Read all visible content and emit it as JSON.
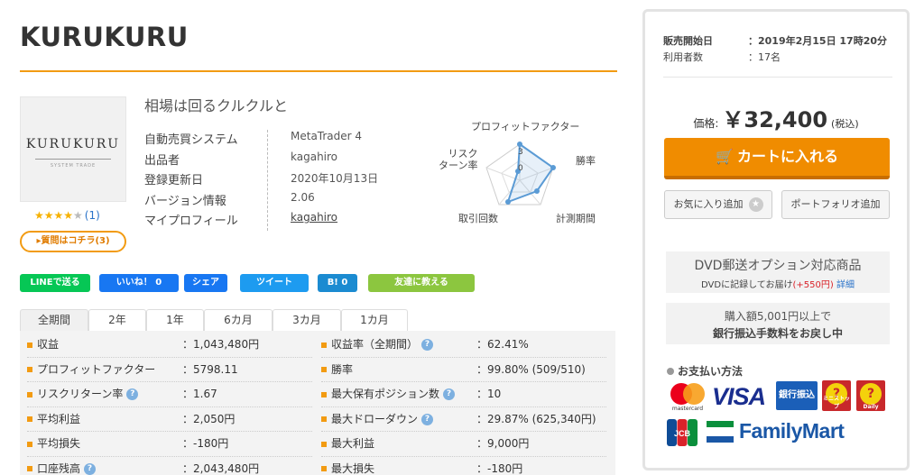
{
  "product": {
    "title": "KURUKURU",
    "logo_text": "KURUKURU",
    "logo_sub": "SYSTEM TRADE",
    "catchphrase": "相場は回るクルクルと",
    "stars_filled": "★★★★",
    "stars_empty": "★",
    "review_count": "(1)",
    "qa_button": "▸質問はコチラ(3)",
    "info": [
      {
        "key": "自動売買システム",
        "value": "MetaTrader 4"
      },
      {
        "key": "出品者",
        "value": "kagahiro"
      },
      {
        "key": "登録更新日",
        "value": "2020年10月13日"
      },
      {
        "key": "バージョン情報",
        "value": "2.06"
      },
      {
        "key": "マイプロフィール",
        "value": "kagahiro"
      }
    ]
  },
  "radar": {
    "labels": {
      "profit_factor": "プロフィットファクター",
      "win_rate": "勝率",
      "period": "計測期間",
      "trades": "取引回数",
      "risk_return": "リスク\nターン率"
    },
    "scale_labels": [
      "3",
      "0"
    ]
  },
  "social": {
    "line": "LINEで送る",
    "like": "いいね！ 0",
    "share": "シェア",
    "tweet": "ツイート",
    "hatena": "B! 0",
    "tell_friend": "友達に教える"
  },
  "tabs": [
    "全期間",
    "2年",
    "1年",
    "6カ月",
    "3カ月",
    "1カ月"
  ],
  "stats": {
    "left": [
      {
        "label": "収益",
        "value": "：1,043,480円",
        "help": false
      },
      {
        "label": "プロフィットファクター",
        "value": "：5798.11",
        "help": false
      },
      {
        "label": "リスクリターン率",
        "value": "：1.67",
        "help": true
      },
      {
        "label": "平均利益",
        "value": "：2,050円",
        "help": false
      },
      {
        "label": "平均損失",
        "value": "：-180円",
        "help": false
      },
      {
        "label": "口座残高",
        "value": "：2,043,480円",
        "help": true
      }
    ],
    "right": [
      {
        "label": "収益率（全期間）",
        "value": "：62.41%",
        "help": true
      },
      {
        "label": "勝率",
        "value": "：99.80% (509/510)",
        "help": false
      },
      {
        "label": "最大保有ポジション数",
        "value": "：10",
        "help": true
      },
      {
        "label": "最大ドローダウン",
        "value": "：29.87% (625,340円)",
        "help": true
      },
      {
        "label": "最大利益",
        "value": "：9,000円",
        "help": false
      },
      {
        "label": "最大損失",
        "value": "：-180円",
        "help": false
      }
    ]
  },
  "sidebar": {
    "sale_start_label": "販売開始日",
    "sale_start_value": "：2019年2月15日 17時20分",
    "users_label": "利用者数",
    "users_value": "：17名",
    "price_label": "価格:",
    "price_value": "￥32,400",
    "price_tax": "(税込)",
    "cart_button": "カートに入れる",
    "favorite_button": "お気に入り追加",
    "portfolio_button": "ポートフォリオ追加",
    "dvd_title": "DVD郵送オプション対応商品",
    "dvd_desc": "DVDに記録してお届け",
    "dvd_price": "(+550円)",
    "dvd_link": "詳細",
    "bank_line1": "購入額5,001円以上で",
    "bank_line2": "銀行振込手数料をお戻し中",
    "payment_title": "お支払い方法",
    "payment": {
      "mastercard": "mastercard",
      "visa": "VISA",
      "bank": "銀行振込",
      "ministop_sub": "ミニストップ",
      "daily_sub": "Daily",
      "jcb": "JCB",
      "familymart": "FamilyMart"
    }
  },
  "colors": {
    "accent": "#f29b12",
    "cart": "#f08c00",
    "link": "#2a73c9",
    "radar_line": "#5b9bd5"
  }
}
